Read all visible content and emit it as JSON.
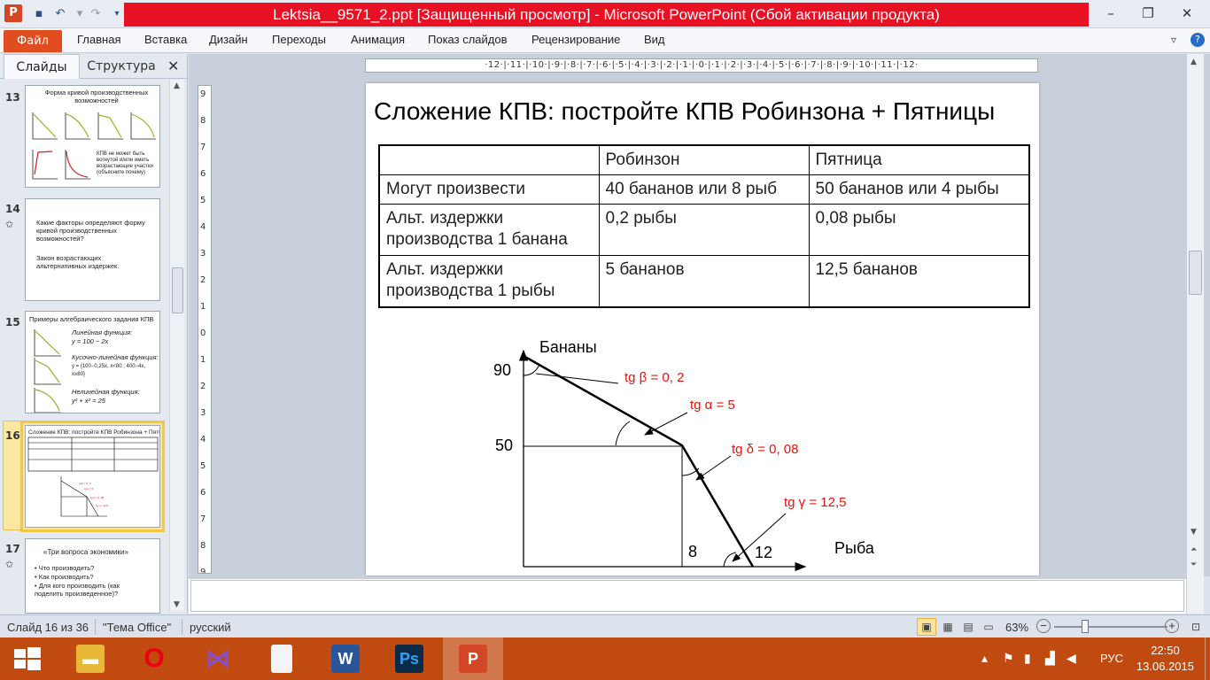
{
  "window": {
    "title": "Lektsia__9571_2.ppt [Защищенный просмотр] - Microsoft PowerPoint (Сбой активации продукта)",
    "app_icon": "P",
    "minimize": "–",
    "maximize": "❐",
    "close": "✕"
  },
  "ribbon": {
    "file": "Файл",
    "tabs": [
      "Главная",
      "Вставка",
      "Дизайн",
      "Переходы",
      "Анимация",
      "Показ слайдов",
      "Рецензирование",
      "Вид"
    ]
  },
  "panel": {
    "tab_slides": "Слайды",
    "tab_outline": "Структура",
    "close": "✕",
    "thumbnails": [
      {
        "num": "13",
        "title": "Форма кривой производственных возможностей",
        "note": "КПВ не может быть вогнутой и/или иметь возрастающие участки (объясните почему)"
      },
      {
        "num": "14",
        "lines": [
          "Какие факторы определяют форму кривой производственных возможностей?",
          "Закон возрастающих альтернативных издержек."
        ]
      },
      {
        "num": "15",
        "title": "Примеры алгебраического задания КПВ",
        "items": [
          "Линейная функция:",
          "y = 100 − 2x",
          "Кусочно-линейная функция:",
          "Нелинейная функция:",
          "y² + x² = 25"
        ]
      },
      {
        "num": "16",
        "title": "Сложение КПВ: постройте КПВ Робинзона + Пятницы"
      },
      {
        "num": "17",
        "title": "«Три вопроса экономики»",
        "items": [
          "Что производить?",
          "Как производить?",
          "Для кого производить (как поделить произведенное)?"
        ]
      }
    ]
  },
  "ruler": {
    "horizontal": "·12·|·11·|·10·|·9·|·8·|·7·|·6·|·5·|·4·|·3·|·2·|·1·|·0·|·1·|·2·|·3·|·4·|·5·|·6·|·7·|·8·|·9·|·10·|·11·|·12·",
    "vertical": [
      "9",
      "8",
      "7",
      "6",
      "5",
      "4",
      "3",
      "2",
      "1",
      "0",
      "1",
      "2",
      "3",
      "4",
      "5",
      "6",
      "7",
      "8",
      "9"
    ]
  },
  "slide": {
    "title": "Сложение КПВ: постройте КПВ Робинзона + Пятницы",
    "table": {
      "header": [
        "",
        "Робинзон",
        "Пятница"
      ],
      "rows": [
        [
          "Могут произвести",
          "40 бананов или 8 рыб",
          "50 бананов или 4 рыбы"
        ],
        [
          "Альт. издержки производства 1 банана",
          "0,2 рыбы",
          "0,08 рыбы"
        ],
        [
          "Альт. издержки производства 1 рыбы",
          "5 бананов",
          "12,5 бананов"
        ]
      ]
    },
    "graph": {
      "y_axis_label": "Бананы",
      "x_axis_label": "Рыба",
      "y_ticks": [
        "90",
        "50"
      ],
      "x_ticks": [
        "8",
        "12"
      ],
      "annotations": [
        "tg β = 0, 2",
        "tg α = 5",
        "tg δ = 0, 08",
        "tg γ = 12,5"
      ],
      "annotation_color": "#e8120c"
    }
  },
  "status": {
    "slide_counter": "Слайд 16 из 36",
    "theme": "\"Тема Office\"",
    "language": "русский",
    "zoom": "63%",
    "zoom_out": "−",
    "zoom_in": "+"
  },
  "taskbar": {
    "apps": [
      {
        "name": "Проводник",
        "icon": "folder-icon"
      },
      {
        "name": "Opera",
        "icon": "opera-icon",
        "letter": "O"
      },
      {
        "name": "Visual Studio",
        "icon": "vs-icon"
      },
      {
        "name": "Документ",
        "icon": "document-icon"
      },
      {
        "name": "Word",
        "icon": "word-icon",
        "letter": "W"
      },
      {
        "name": "Photoshop",
        "icon": "photoshop-icon",
        "letter": "Ps"
      },
      {
        "name": "PowerPoint",
        "icon": "powerpoint-icon",
        "letter": "P"
      }
    ],
    "lang": "РУС",
    "time": "22:50",
    "date": "13.06.2015"
  },
  "colors": {
    "accent_orange": "#d24726",
    "taskbar": "#c04a10",
    "title_red": "#e81123",
    "selection": "#f4c645"
  }
}
